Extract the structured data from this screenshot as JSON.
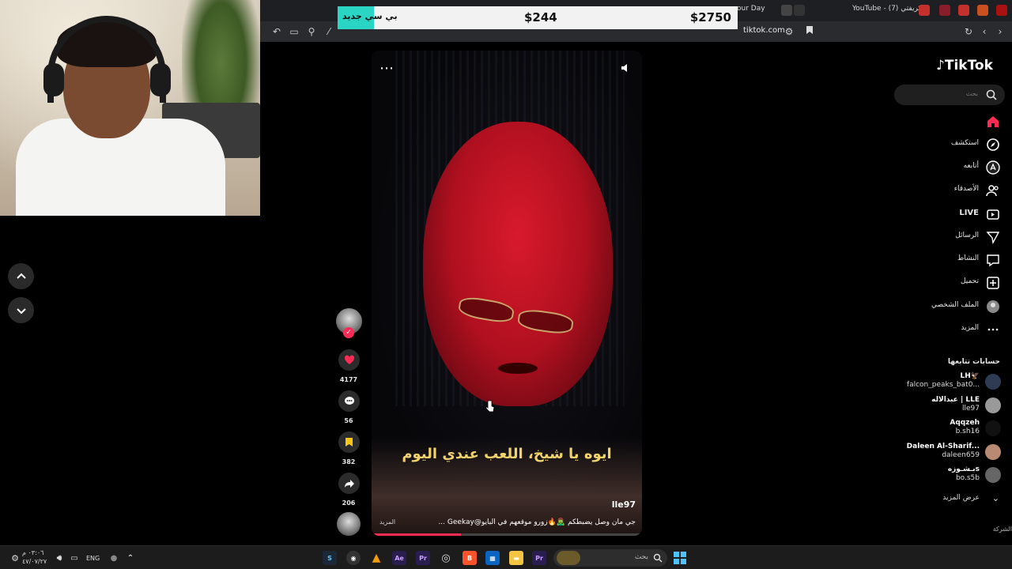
{
  "browser": {
    "tabs": [
      {
        "label": "our Day"
      },
      {
        "label": "YouTube - (7) كريفتي"
      }
    ],
    "url": "tiktok.com"
  },
  "overlay": {
    "left_label": "بي سي جديد",
    "mid_price": "$244",
    "right_price": "$2750",
    "accent": "#2bd5c4"
  },
  "tiktok": {
    "logo": "TikTok",
    "search_placeholder": "بحث",
    "nav": [
      {
        "label": "",
        "icon": "home-icon",
        "active": true
      },
      {
        "label": "استكشف",
        "icon": "compass-icon"
      },
      {
        "label": "أتابعه",
        "icon": "following-icon"
      },
      {
        "label": "الأصدقاء",
        "icon": "friends-icon"
      },
      {
        "label": "LIVE",
        "icon": "live-icon"
      },
      {
        "label": "الرسائل",
        "icon": "send-icon"
      },
      {
        "label": "النشاط",
        "icon": "activity-icon"
      },
      {
        "label": "تحميل",
        "icon": "upload-icon"
      },
      {
        "label": "الملف الشخصي",
        "icon": "profile-avatar-icon"
      },
      {
        "label": "المزيد",
        "icon": "more-icon"
      }
    ],
    "following_title": "حسابات تتابعها",
    "following": [
      {
        "name": "LH🦅",
        "handle": "falcon_peaks_bat0..."
      },
      {
        "name": "عبدالاله | LLE",
        "handle": "lle97"
      },
      {
        "name": "Aqqzeh",
        "handle": "b.sh16"
      },
      {
        "name": "Daleen Al-Sharif...",
        "handle": "daleen659"
      },
      {
        "name": "بـشـوزهs",
        "handle": "bo.s5b"
      }
    ],
    "show_more": "عرض المزيد",
    "footer_cut": "الشركة",
    "brand_pink": "#fe2c55"
  },
  "video": {
    "caption": "ايوه يا شيخ، اللعب عندي اليوم",
    "author": "lle97",
    "description": "جي مان وصل يضبطكم 🧟‍♂️🔥زورو موقعهم في البايو@Geekay ...",
    "desc_more": "المزيد",
    "progress": 0.33
  },
  "actions": {
    "likes": "4177",
    "comments": "56",
    "saves": "382",
    "shares": "206"
  },
  "taskbar": {
    "search_text": "بحث",
    "lang": "ENG",
    "time": "٠٣:٠٦ م",
    "date": "٤٧/٠٧/٢٧"
  }
}
